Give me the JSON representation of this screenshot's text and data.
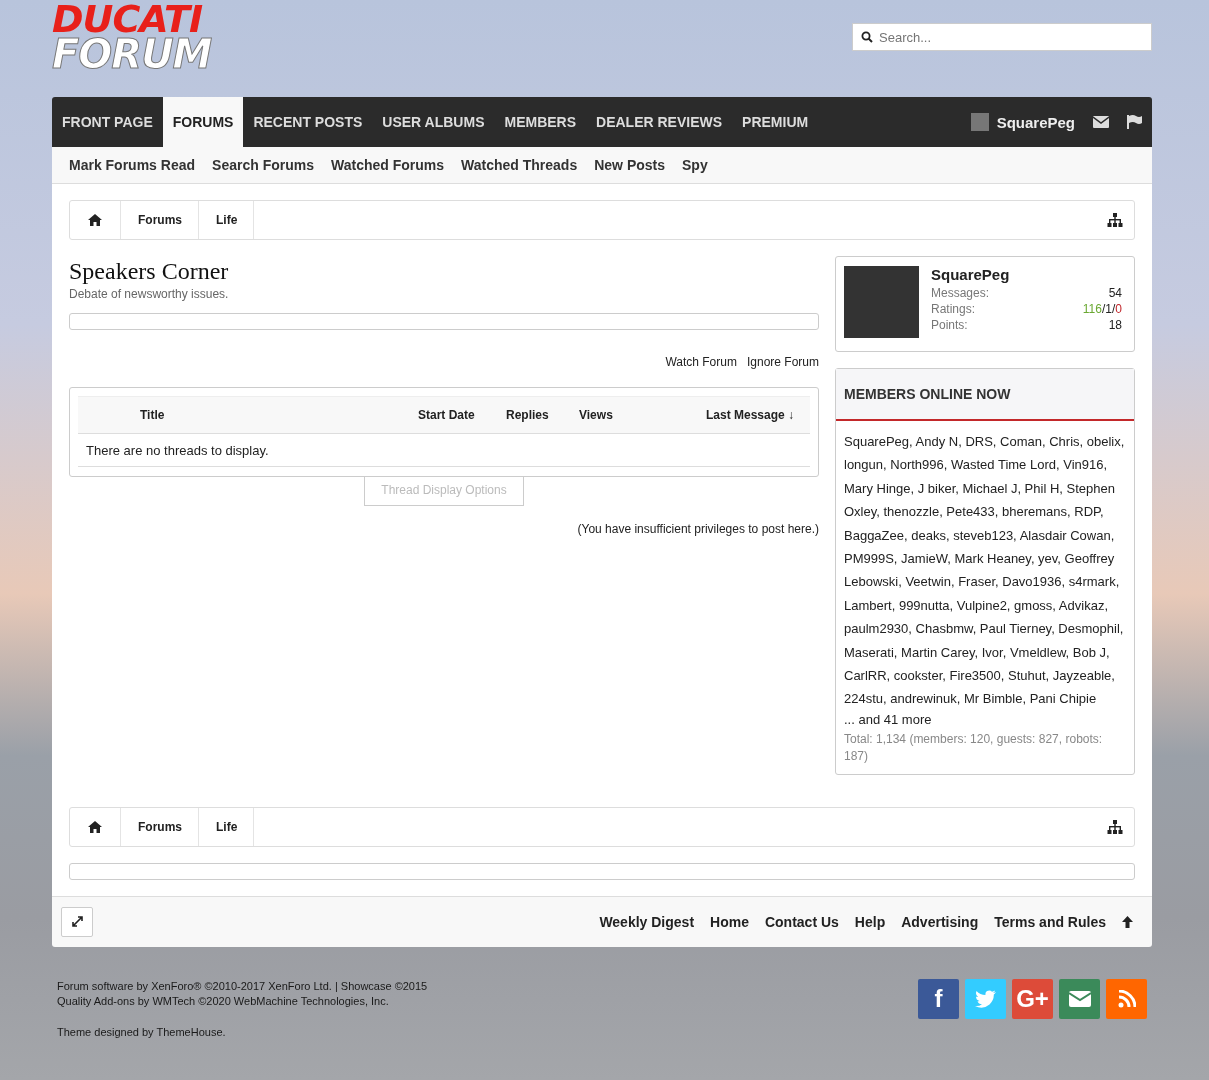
{
  "logo": {
    "line_1": "DUCATI",
    "line_2": "FORUM"
  },
  "search": {
    "placeholder": "Search..."
  },
  "nav": {
    "tabs": [
      {
        "label": "FRONT PAGE",
        "selected": false
      },
      {
        "label": "FORUMS",
        "selected": true
      },
      {
        "label": "RECENT POSTS",
        "selected": false
      },
      {
        "label": "USER ALBUMS",
        "selected": false
      },
      {
        "label": "MEMBERS",
        "selected": false
      },
      {
        "label": "DEALER REVIEWS",
        "selected": false
      },
      {
        "label": "PREMIUM",
        "selected": false
      }
    ],
    "user": "SquarePeg"
  },
  "subnav": [
    "Mark Forums Read",
    "Search Forums",
    "Watched Forums",
    "Watched Threads",
    "New Posts",
    "Spy"
  ],
  "breadcrumb_top": [
    "Forums",
    "Life"
  ],
  "breadcrumb_bottom": [
    "Forums",
    "Life"
  ],
  "forum": {
    "title": "Speakers Corner",
    "description": "Debate of newsworthy issues.",
    "actions": [
      "Watch Forum",
      "Ignore Forum"
    ]
  },
  "table": {
    "columns": [
      "Title",
      "Start Date",
      "Replies",
      "Views",
      "Last Message ↓"
    ],
    "empty": "There are no threads to display.",
    "options": "Thread Display Options"
  },
  "notice": "(You have insufficient privileges to post here.)",
  "profile": {
    "name": "SquarePeg",
    "stats": [
      {
        "label": "Messages:",
        "kind": "plain",
        "value": "54"
      },
      {
        "label": "Ratings:",
        "kind": "ratings",
        "positive": "116",
        "neutral": "/1/",
        "negative": "0"
      },
      {
        "label": "Points:",
        "kind": "plain",
        "value": "18"
      }
    ]
  },
  "members_online": {
    "title": "MEMBERS ONLINE NOW",
    "members": "SquarePeg, Andy N, DRS, Coman, Chris, obelix, longun, North996, Wasted Time Lord, Vin916, Mary Hinge, J biker, Michael J, Phil H, Stephen Oxley, thenozzle, Pete433, bheremans, RDP, BaggaZee, deaks, steveb123, Alasdair Cowan, PM999S, JamieW, Mark Heaney, yev, Geoffrey Lebowski, Veetwin, Fraser, Davo1936, s4rmark, Lambert, 999nutta, Vulpine2, gmoss, Advikaz, paulm2930, Chasbmw, Paul Tierney, Desmophil, Maserati, Martin Carey, Ivor, Vmeldlew, Bob J, CarlRR, cookster, Fire3500, Stuhut, Jayzeable, 224stu, andrewinuk, Mr Bimble, Pani Chipie",
    "more": "... and 41 more",
    "total": "Total: 1,134 (members: 120, guests: 827, robots: 187)"
  },
  "footer_links": [
    "Weekly Digest",
    "Home",
    "Contact Us",
    "Help",
    "Advertising",
    "Terms and Rules"
  ],
  "copyright": [
    "Forum software by XenForo® ©2010-2017 XenForo Ltd. | Showcase ©2015",
    "Quality Add-ons by WMTech ©2020 WebMachine Technologies, Inc.",
    "Theme designed by ThemeHouse."
  ],
  "social": [
    {
      "kind": "facebook",
      "label": "f",
      "color": "#3b5998"
    },
    {
      "kind": "twitter",
      "color": "#33ccff"
    },
    {
      "kind": "google",
      "label": "G+",
      "color": "#dd4b39"
    },
    {
      "kind": "email",
      "color": "#3b8a5a"
    },
    {
      "kind": "rss",
      "color": "#ff6600"
    }
  ]
}
